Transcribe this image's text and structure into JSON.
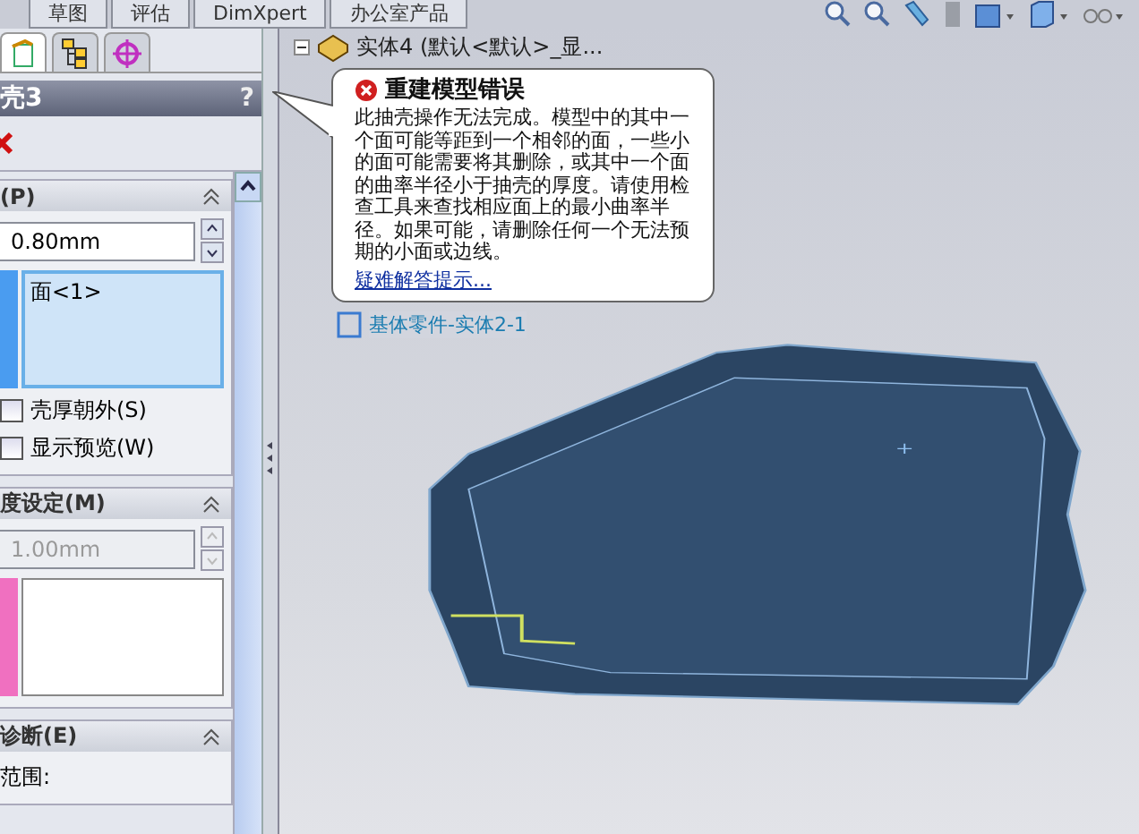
{
  "top_tabs": [
    {
      "label": "草图",
      "selected": false
    },
    {
      "label": "评估",
      "selected": false
    },
    {
      "label": "DimXpert",
      "selected": false
    },
    {
      "label": "办公室产品",
      "selected": false
    }
  ],
  "panel_tabs": [
    {
      "kind": "property",
      "selected": true
    },
    {
      "kind": "config",
      "selected": false
    },
    {
      "kind": "target",
      "selected": false
    }
  ],
  "property_manager": {
    "title": "壳3",
    "help": "?",
    "parameters": {
      "header": "(P)",
      "thickness": "0.80mm",
      "faces": [
        "面<1>"
      ]
    },
    "options": [
      {
        "label": "壳厚朝外(S)",
        "checked": false
      },
      {
        "label": "显示预览(W)",
        "checked": false
      }
    ],
    "multi_thickness": {
      "header": "度设定(M)",
      "thickness": "1.00mm",
      "disabled": true
    },
    "diagnostics": {
      "header": "诊断(E)",
      "label": "范围:"
    }
  },
  "feature_tree": {
    "root": "实体4  (默认<默认>_显...",
    "expanded": true,
    "children": [
      {
        "label": "基体零件-实体2-1"
      }
    ]
  },
  "error_callout": {
    "title": "重建模型错误",
    "message": "此抽壳操作无法完成。模型中的其中一个面可能等距到一个相邻的面，一些小的面可能需要将其删除，或其中一个面的曲率半径小于抽壳的厚度。请使用检查工具来查找相应面上的最小曲率半径。如果可能，请删除任何一个无法预期的小面或边线。",
    "link": "疑难解答提示..."
  }
}
